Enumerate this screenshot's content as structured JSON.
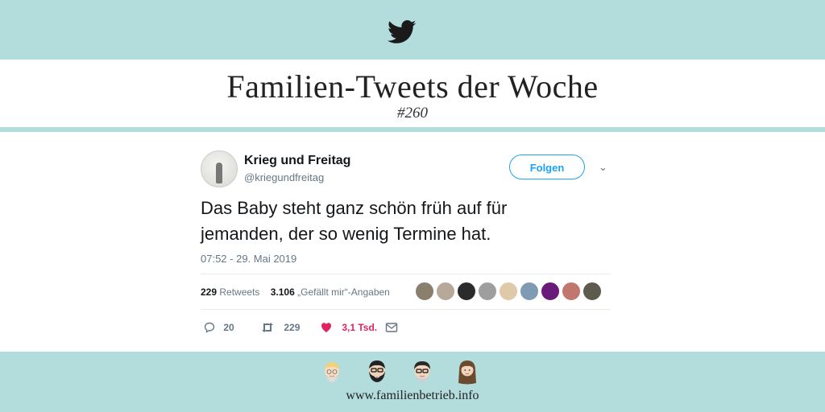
{
  "header": {
    "icon": "twitter-bird-icon",
    "title": "Familien-Tweets der Woche",
    "issue": "#260"
  },
  "tweet": {
    "display_name": "Krieg und Freitag",
    "handle": "@kriegundfreitag",
    "follow_label": "Folgen",
    "text": "Das Baby steht ganz schön früh auf für jemanden, der so wenig Termine hat.",
    "timestamp": "07:52 - 29. Mai 2019",
    "retweets_count": "229",
    "retweets_label": "Retweets",
    "likes_count": "3.106",
    "likes_label": "„Gefällt mir“-Angaben",
    "liker_avatars": [
      "#8a7f6d",
      "#b7a89a",
      "#2b2b2b",
      "#9e9e9e",
      "#e0c9a8",
      "#7e9bb3",
      "#6a1b7a",
      "#c0786e",
      "#5f5a4e"
    ],
    "actions": {
      "reply_count": "20",
      "retweet_count": "229",
      "like_count": "3,1 Tsd.",
      "like_color": "#e0245e"
    }
  },
  "footer": {
    "url": "www.familienbetrieb.info",
    "family_icons": [
      "blonde-boy-icon",
      "bearded-man-icon",
      "glasses-man-icon",
      "long-hair-woman-icon"
    ]
  },
  "colors": {
    "band": "#b3dcdd",
    "accent": "#1da1f2"
  }
}
